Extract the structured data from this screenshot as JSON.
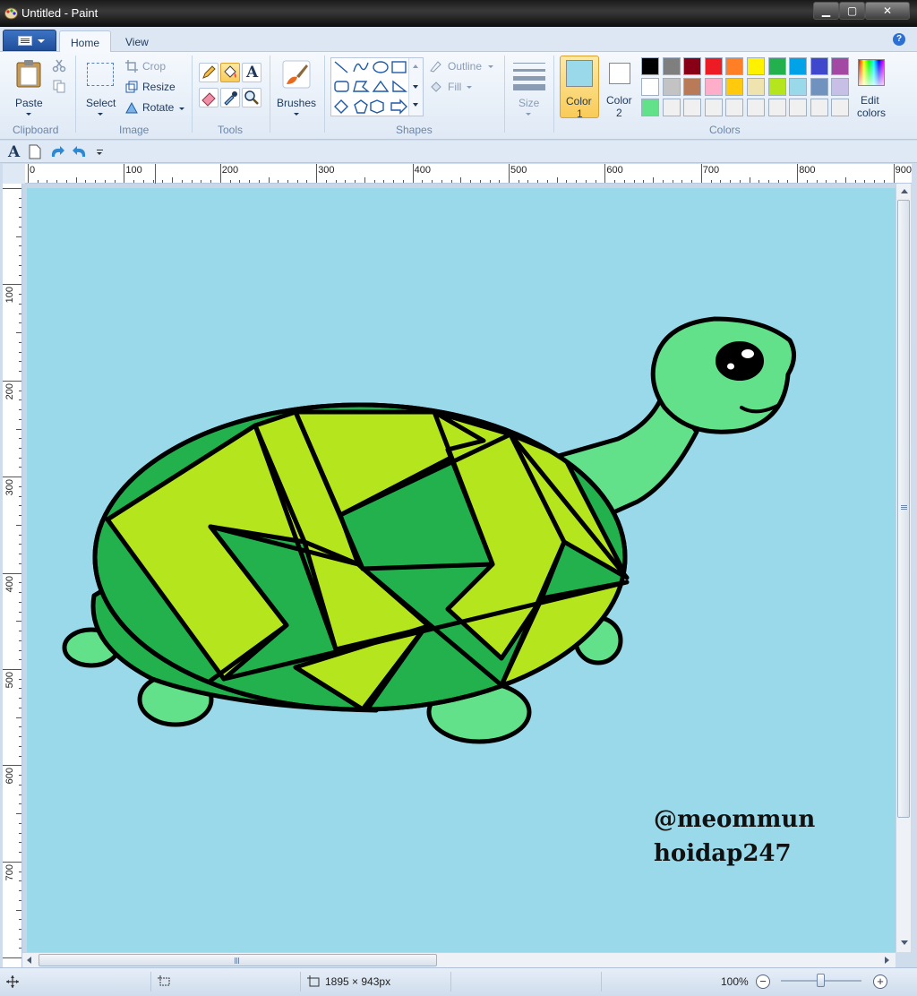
{
  "window": {
    "title": "Untitled - Paint",
    "controls": {
      "minimize": "▁",
      "maximize": "▢",
      "close": "✕"
    }
  },
  "tabs": [
    {
      "label": "Home"
    },
    {
      "label": "View"
    }
  ],
  "ribbon": {
    "clipboard": {
      "paste": "Paste",
      "group": "Clipboard"
    },
    "image": {
      "select": "Select",
      "crop": "Crop",
      "resize": "Resize",
      "rotate": "Rotate",
      "group": "Image"
    },
    "tools": {
      "group": "Tools"
    },
    "brushes": {
      "label": "Brushes"
    },
    "shapes": {
      "outline": "Outline",
      "fill": "Fill",
      "group": "Shapes"
    },
    "size": {
      "label": "Size"
    },
    "colors": {
      "color1_label": "Color",
      "color1_num": "1",
      "color2_label": "Color",
      "color2_num": "2",
      "edit_label_1": "Edit",
      "edit_label_2": "colors",
      "group": "Colors",
      "color1": "#99d9ea",
      "color2": "#ffffff",
      "palette_row1": [
        "#000000",
        "#7f7f7f",
        "#880015",
        "#ed1c24",
        "#ff7f27",
        "#fff200",
        "#22b14c",
        "#00a2e8",
        "#3f48cc",
        "#a349a4"
      ],
      "palette_row2": [
        "#ffffff",
        "#c3c3c3",
        "#b97a57",
        "#ffaec9",
        "#ffc90e",
        "#efe4b0",
        "#b5e61d",
        "#99d9ea",
        "#7092be",
        "#c8bfe7"
      ],
      "palette_row3": [
        "#62e08a",
        "#f0f0f0",
        "#f0f0f0",
        "#f0f0f0",
        "#f0f0f0",
        "#f0f0f0",
        "#f0f0f0",
        "#f0f0f0",
        "#f0f0f0",
        "#f0f0f0"
      ]
    }
  },
  "ruler": {
    "h_ticks": [
      "0",
      "100",
      "200",
      "300",
      "400",
      "500",
      "600",
      "700",
      "800",
      "900"
    ],
    "v_ticks": [
      "100",
      "200",
      "300",
      "400",
      "500",
      "600",
      "700"
    ]
  },
  "canvas": {
    "background": "#99d9ea",
    "watermark_line1": "@meommun",
    "watermark_line2": "hoidap247",
    "colors": {
      "shell_dark": "#22b14c",
      "shell_light": "#b5e61d",
      "body": "#62e08a",
      "outline": "#000000"
    }
  },
  "status": {
    "image_size": "1895 × 943px",
    "zoom": "100%"
  }
}
